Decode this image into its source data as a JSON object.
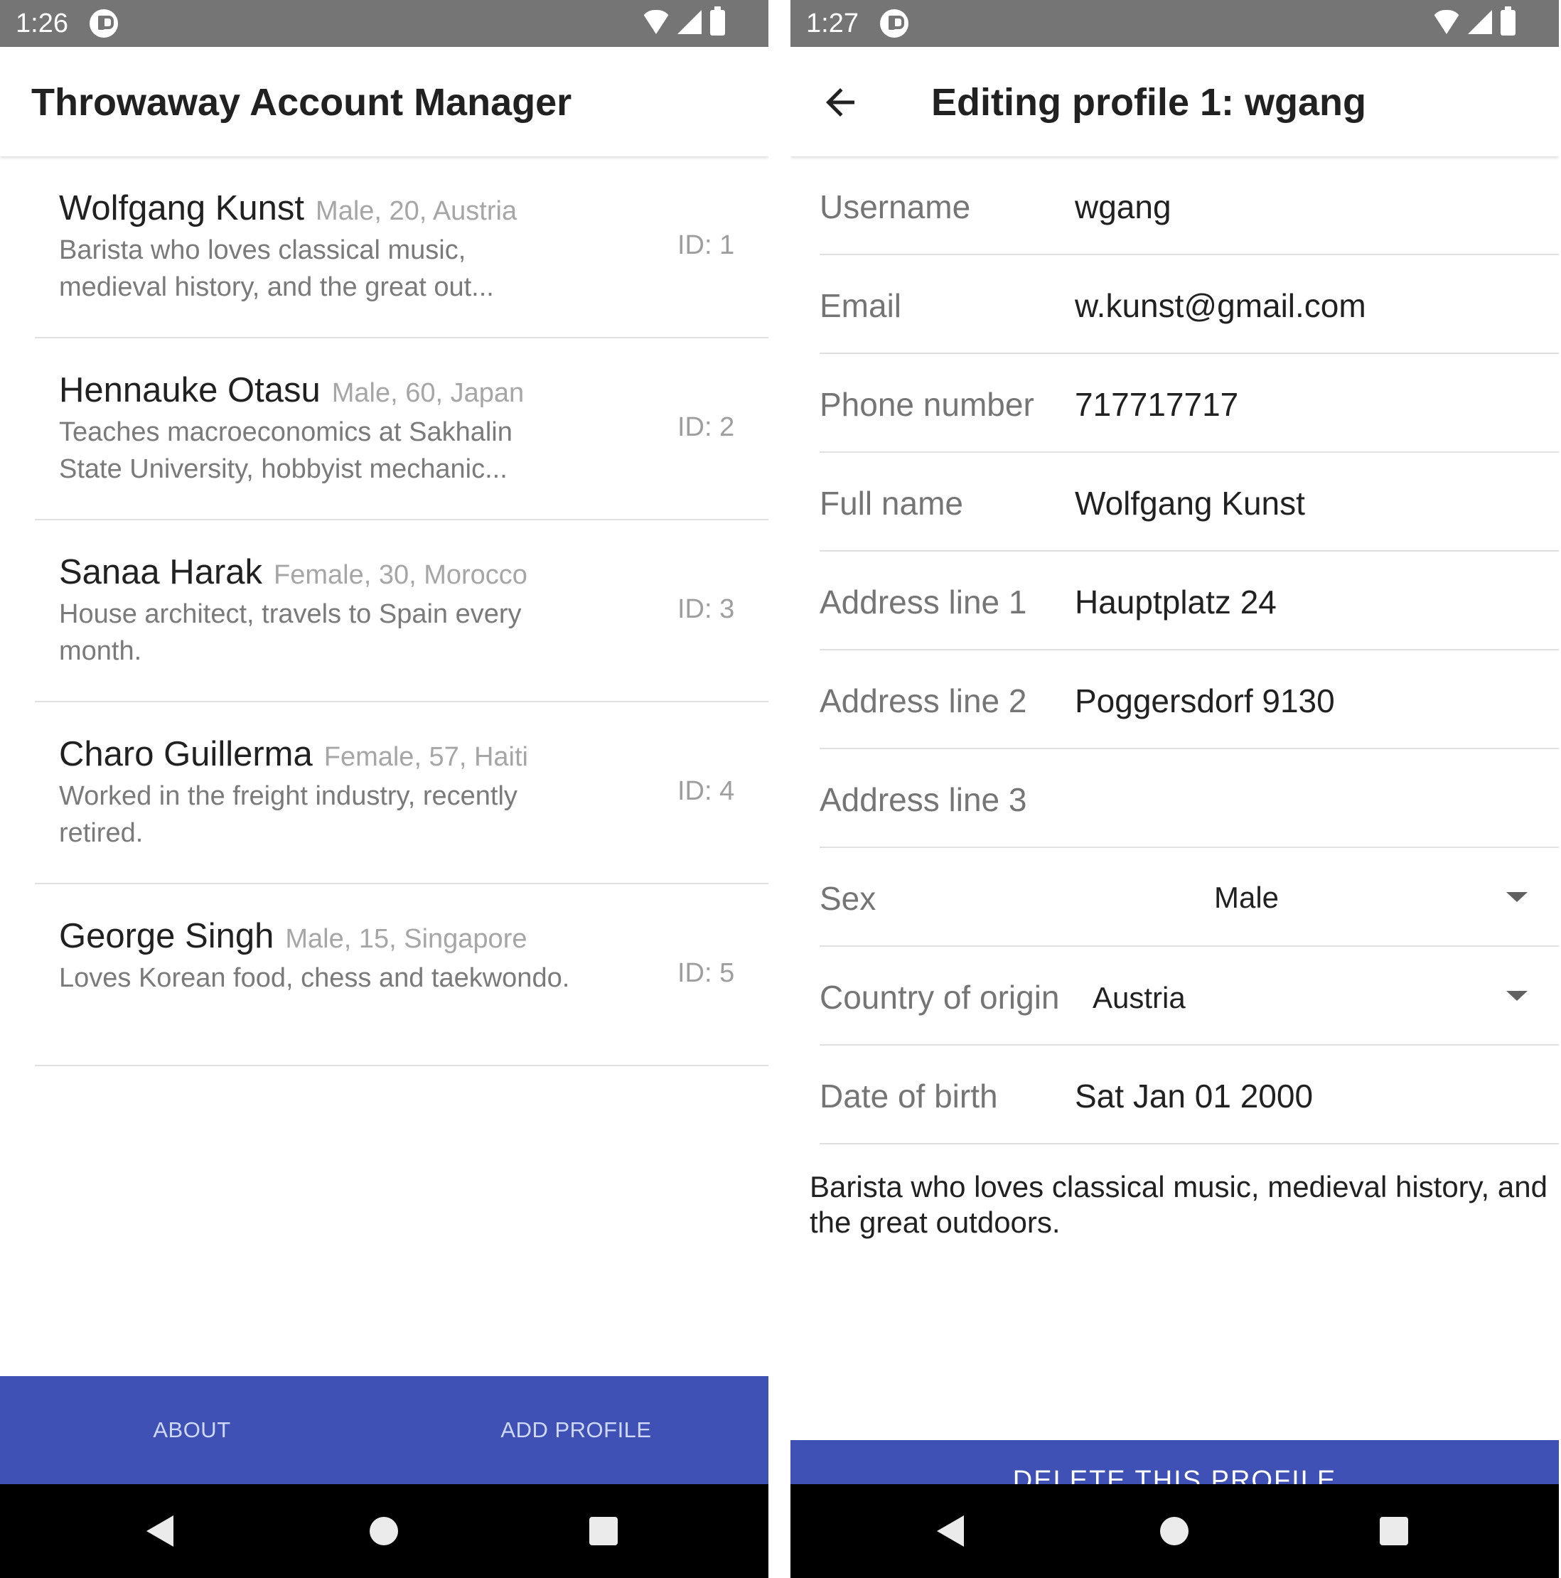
{
  "left_screen": {
    "status_bar": {
      "time": "1:26"
    },
    "app_bar": {
      "title": "Throwaway Account Manager"
    },
    "profiles": [
      {
        "name": "Wolfgang Kunst",
        "meta": "Male, 20, Austria",
        "description": "Barista who loves classical music, medieval history, and the great out...",
        "id_label": "ID: 1"
      },
      {
        "name": "Hennauke Otasu",
        "meta": "Male, 60, Japan",
        "description": "Teaches macroeconomics at Sakhalin State University, hobbyist mechanic...",
        "id_label": "ID: 2"
      },
      {
        "name": "Sanaa Harak",
        "meta": "Female, 30, Morocco",
        "description": "House architect, travels to Spain every month.",
        "id_label": "ID: 3"
      },
      {
        "name": "Charo Guillerma",
        "meta": "Female, 57, Haiti",
        "description": "Worked in the freight industry, recently retired.",
        "id_label": "ID: 4"
      },
      {
        "name": "George Singh",
        "meta": "Male, 15, Singapore",
        "description": "Loves Korean food, chess and taekwondo.",
        "id_label": "ID: 5"
      }
    ],
    "bottom_bar": {
      "about_label": "ABOUT",
      "add_profile_label": "ADD PROFILE"
    }
  },
  "right_screen": {
    "status_bar": {
      "time": "1:27"
    },
    "app_bar": {
      "title": "Editing profile 1: wgang"
    },
    "form": {
      "username": {
        "label": "Username",
        "value": "wgang"
      },
      "email": {
        "label": "Email",
        "value": "w.kunst@gmail.com"
      },
      "phone": {
        "label": "Phone number",
        "value": "717717717"
      },
      "full_name": {
        "label": "Full name",
        "value": "Wolfgang Kunst"
      },
      "address1": {
        "label": "Address line 1",
        "value": "Hauptplatz 24"
      },
      "address2": {
        "label": "Address line 2",
        "value": "Poggersdorf 9130"
      },
      "address3": {
        "label": "Address line 3",
        "value": ""
      },
      "sex": {
        "label": "Sex",
        "value": "Male"
      },
      "country": {
        "label": "Country of origin",
        "value": "Austria"
      },
      "dob": {
        "label": "Date of birth",
        "value": "Sat Jan 01 2000"
      }
    },
    "bio": "Barista who loves classical music, medieval history, and the great outdoors.",
    "delete_label": "DELETE THIS PROFILE"
  },
  "colors": {
    "primary": "#3f51b5",
    "status_bar": "#757575",
    "nav_bar": "#000000",
    "divider": "#e0e0e0"
  },
  "icons": [
    "wifi-icon",
    "signal-icon",
    "battery-icon",
    "back-arrow-icon",
    "dropdown-arrow-icon",
    "nav-back-icon",
    "nav-home-icon",
    "nav-recents-icon"
  ]
}
